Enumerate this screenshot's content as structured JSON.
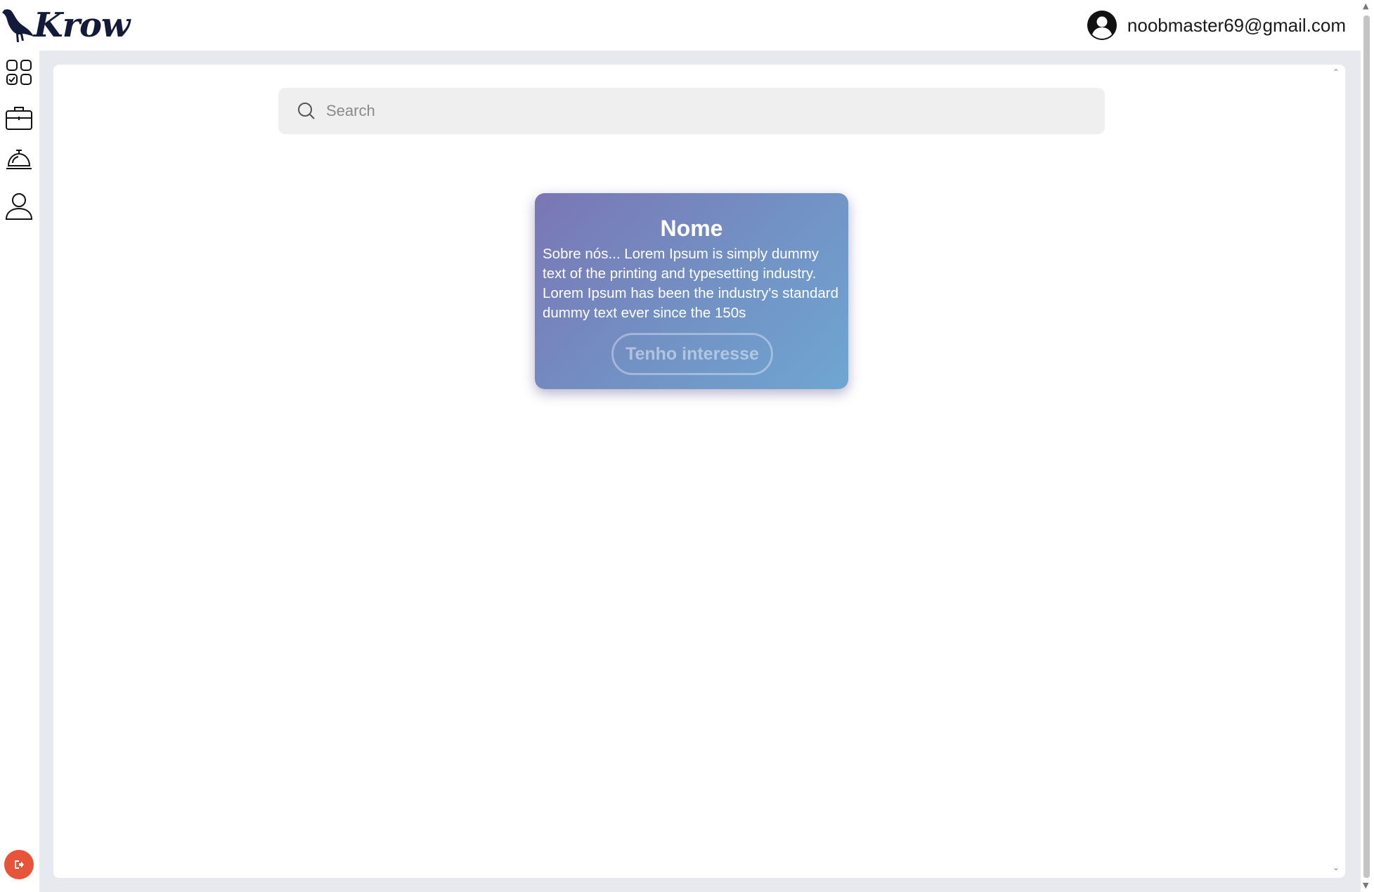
{
  "app": {
    "logo_text": "Krow"
  },
  "header": {
    "user_email": "noobmaster69@gmail.com"
  },
  "sidebar": {
    "items": [
      {
        "icon": "dashboard-grid-icon"
      },
      {
        "icon": "briefcase-icon"
      },
      {
        "icon": "service-bell-icon"
      },
      {
        "icon": "user-profile-icon"
      }
    ],
    "logout": {
      "icon": "logout-icon",
      "color": "#e8543a"
    }
  },
  "search": {
    "placeholder": "Search",
    "value": ""
  },
  "card": {
    "title": "Nome",
    "description": "Sobre nós... Lorem Ipsum is simply dummy text of the printing and typesetting industry. Lorem Ipsum has been the industry's standard dummy text ever since the 150s",
    "button_label": "Tenho interesse",
    "gradient": [
      "#7a76b4",
      "#6fa6d2"
    ]
  },
  "colors": {
    "frame": "#e7e9ef",
    "brand": "#141a3a"
  }
}
